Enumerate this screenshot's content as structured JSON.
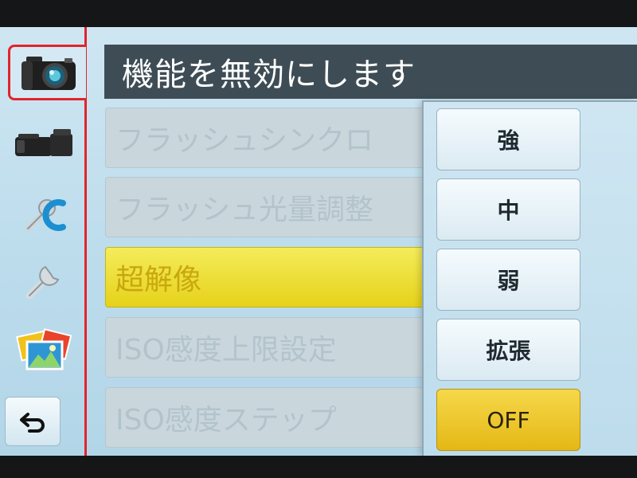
{
  "title": "機能を無効にします",
  "sidebar": {
    "items": [
      {
        "icon": "camera-icon",
        "active": true
      },
      {
        "icon": "video-camera-icon"
      },
      {
        "icon": "custom-wrench-icon"
      },
      {
        "icon": "wrench-icon"
      },
      {
        "icon": "playback-photos-icon"
      }
    ],
    "back_icon": "return-arrow-icon"
  },
  "menu": {
    "items": [
      {
        "label": "フラッシュシンクロ"
      },
      {
        "label": "フラッシュ光量調整"
      },
      {
        "label": "超解像",
        "selected": true
      },
      {
        "label": "ISO感度上限設定"
      },
      {
        "label": "ISO感度ステップ"
      }
    ]
  },
  "options": {
    "items": [
      {
        "label": "強"
      },
      {
        "label": "中"
      },
      {
        "label": "弱"
      },
      {
        "label": "拡張"
      },
      {
        "label": "OFF",
        "selected": true
      }
    ]
  },
  "colors": {
    "accent_red": "#e0252b",
    "highlight_yellow": "#e6d21a",
    "title_bar": "#3e4d55"
  }
}
